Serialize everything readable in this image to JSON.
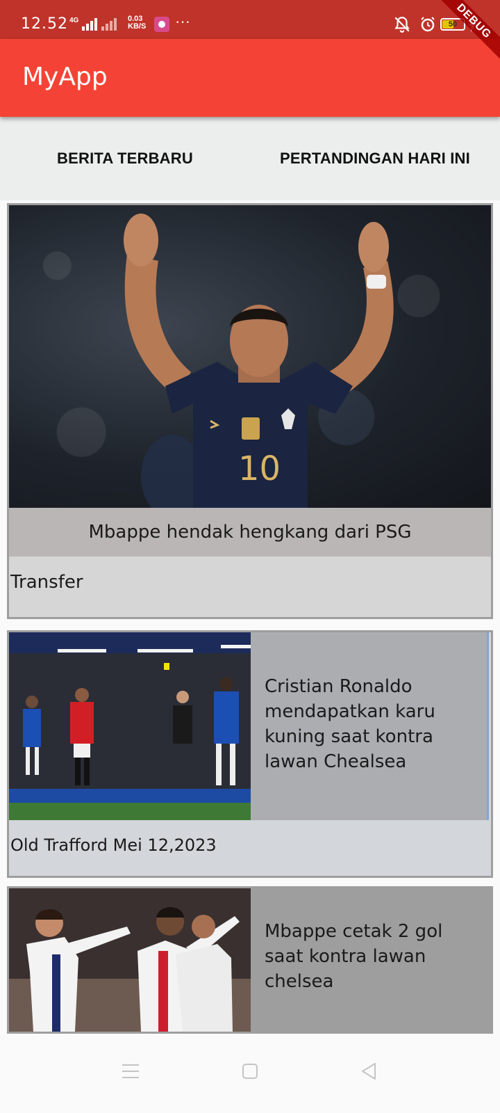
{
  "status_bar": {
    "time": "12.52",
    "network": "4G",
    "speed_value": "0.03",
    "speed_unit": "KB/S",
    "more": "···",
    "battery": "50"
  },
  "app_bar": {
    "title": "MyApp"
  },
  "debug_banner": "DEBUG",
  "tabs": [
    {
      "label": "BERITA TERBARU"
    },
    {
      "label": "PERTANDINGAN HARI INI"
    }
  ],
  "cards": [
    {
      "headline": "Mbappe hendak hengkang dari PSG",
      "category": "Transfer"
    },
    {
      "headline": "Cristian Ronaldo mendapatkan karu kuning saat kontra lawan Chealsea",
      "meta": "Old Trafford Mei 12,2023"
    },
    {
      "headline": "Mbappe cetak 2 gol saat kontra lawan chelsea"
    }
  ],
  "colors": {
    "status_bar": "#c0332a",
    "app_bar": "#f44336",
    "tabs_bg": "#eceeee",
    "card_border": "#9e9e9e"
  },
  "icons": {
    "nav": [
      "menu-icon",
      "home-icon",
      "back-icon"
    ],
    "status": [
      "mute-icon",
      "alarm-icon",
      "battery-icon",
      "charging-icon"
    ]
  }
}
